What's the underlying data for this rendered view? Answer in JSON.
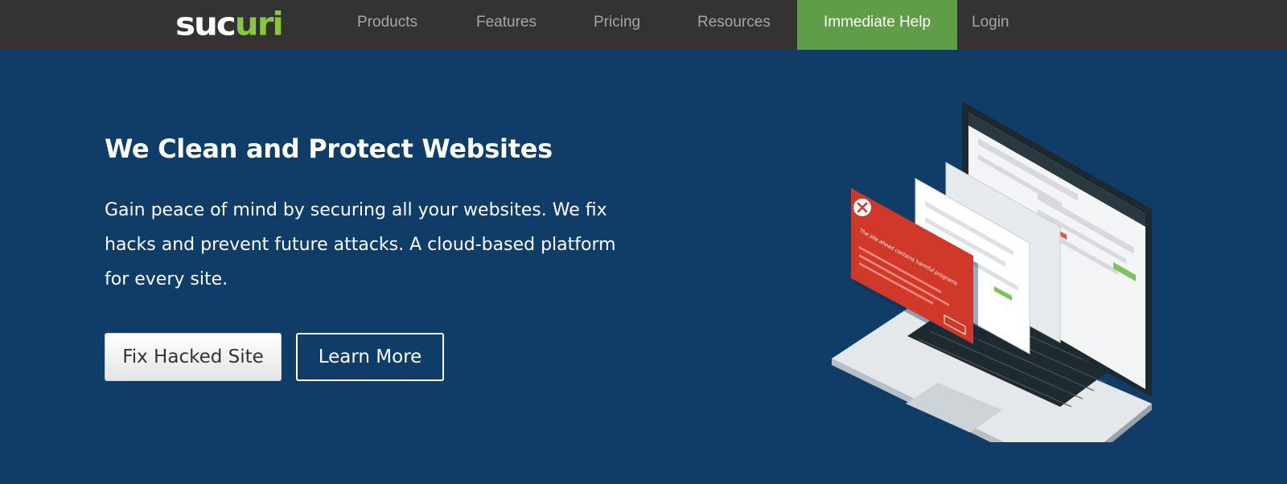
{
  "brand": {
    "logo_main": "suc",
    "logo_accent": "uri"
  },
  "nav": {
    "items": [
      {
        "label": "Products"
      },
      {
        "label": "Features"
      },
      {
        "label": "Pricing"
      },
      {
        "label": "Resources"
      },
      {
        "label": "Immediate Help"
      },
      {
        "label": "Login"
      }
    ]
  },
  "hero": {
    "title": "We Clean and Protect Websites",
    "description": "Gain peace of mind by securing all your websites. We fix hacks and prevent future attacks. A cloud-based platform for every site.",
    "buttons": {
      "fix_label": "Fix Hacked Site",
      "learn_label": "Learn More"
    }
  },
  "illustration": {
    "warning_text": "The site ahead contains harmful programs"
  },
  "colors": {
    "topbar": "#333333",
    "hero_bg": "#0f3d68",
    "accent_green": "#5f9e47",
    "logo_green": "#8bc63f",
    "warning_red": "#d0392a"
  }
}
